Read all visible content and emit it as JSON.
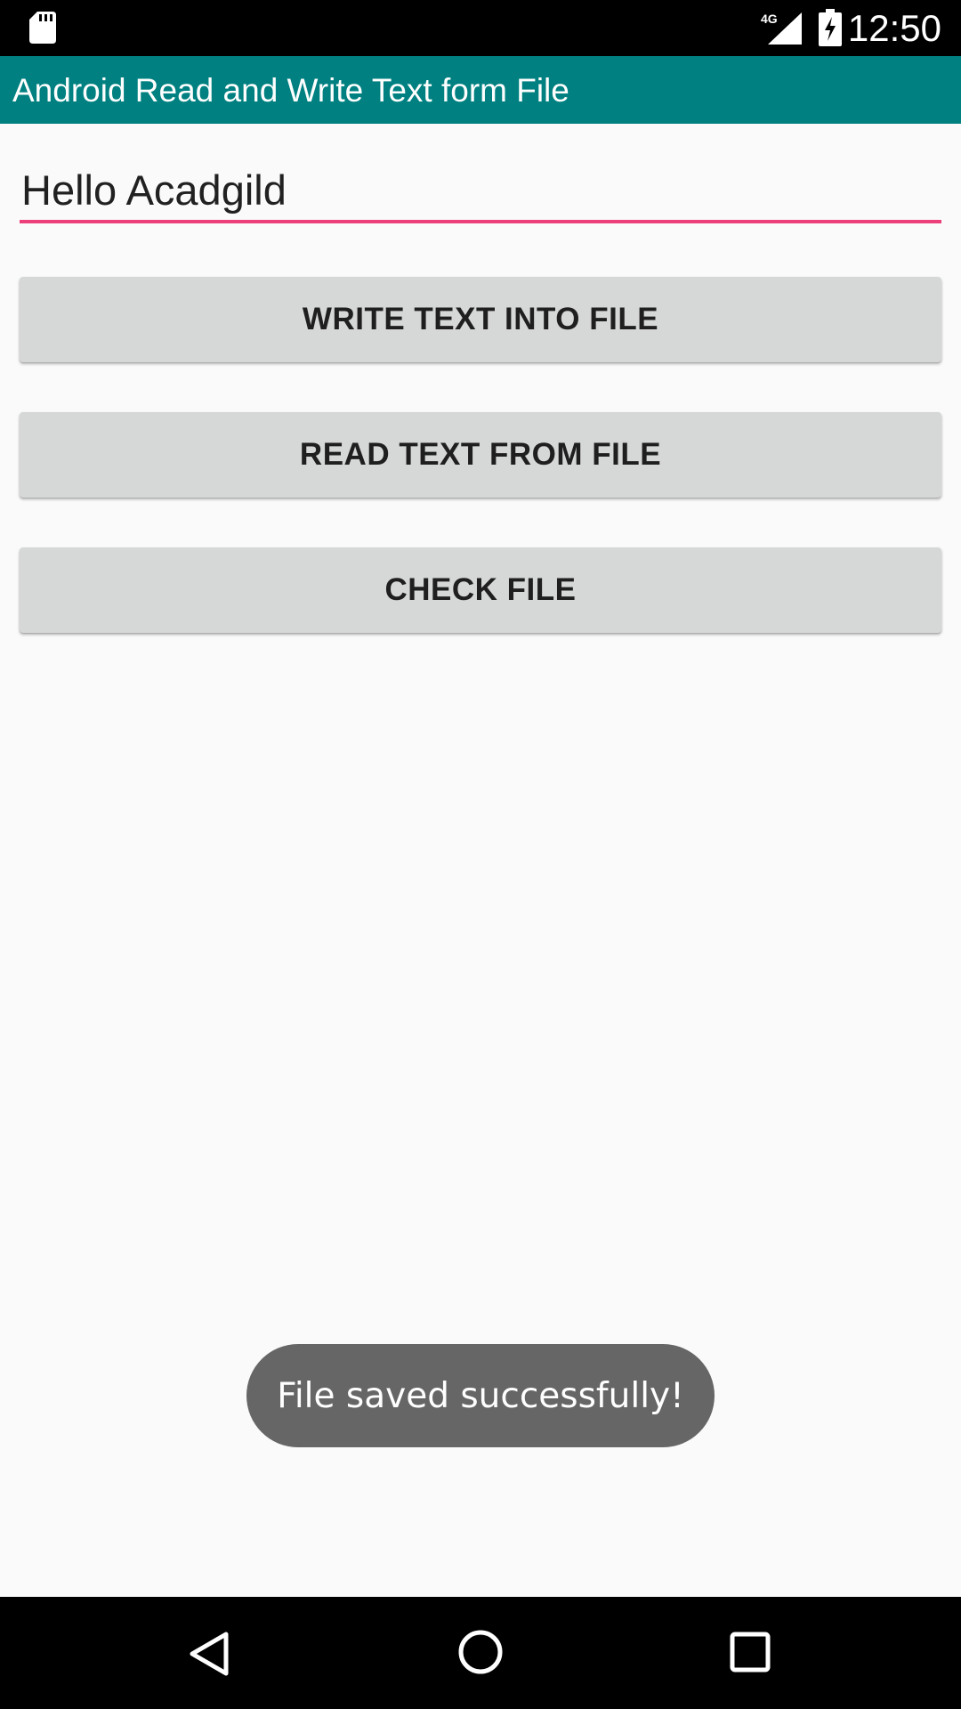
{
  "status_bar": {
    "time": "12:50",
    "network_label": "4G",
    "icons": [
      "sd-card-icon",
      "signal-icon",
      "battery-charging-icon"
    ]
  },
  "app_bar": {
    "title": "Android Read and Write Text form File",
    "color": "#008080"
  },
  "editor": {
    "value": "Hello Acadgild",
    "underline_color": "#ec407a"
  },
  "buttons": {
    "write_label": "WRITE TEXT INTO FILE",
    "read_label": "READ TEXT FROM FILE",
    "check_label": "CHECK FILE"
  },
  "toast": {
    "message": "File saved successfully!"
  },
  "nav_bar": {
    "icons": [
      "back-icon",
      "home-icon",
      "recents-icon"
    ]
  }
}
